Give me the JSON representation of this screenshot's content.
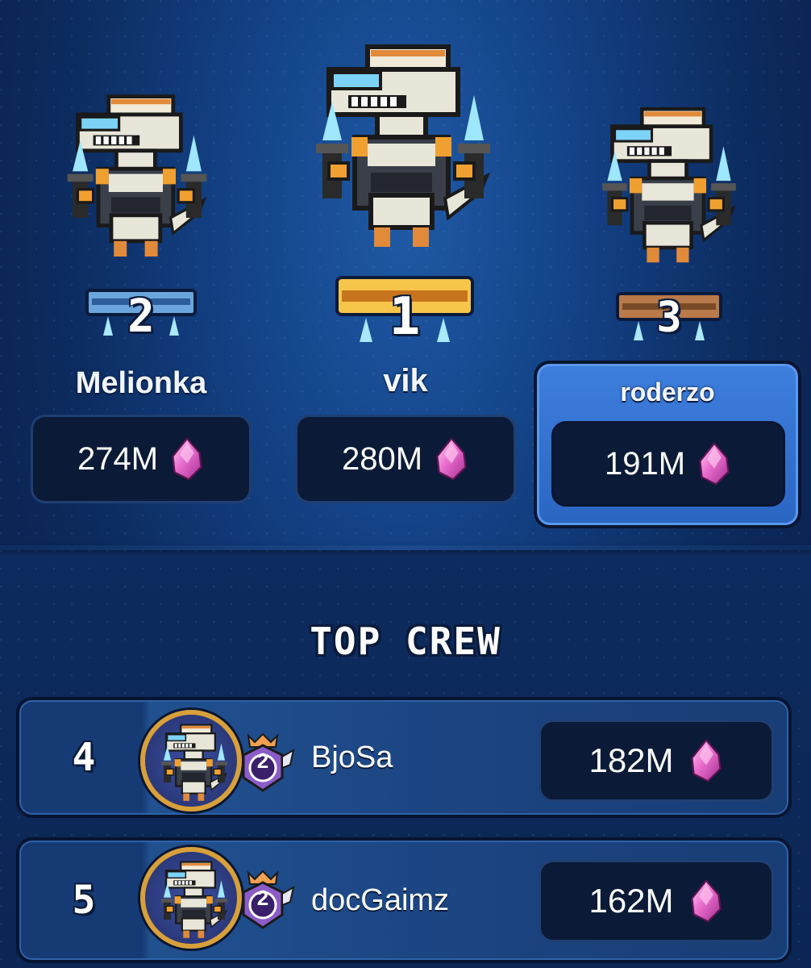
{
  "podium": [
    {
      "rank": "2",
      "name": "Melionka",
      "score": "274M"
    },
    {
      "rank": "1",
      "name": "vik",
      "score": "280M"
    },
    {
      "rank": "3",
      "name": "roderzo",
      "score": "191M"
    }
  ],
  "section": {
    "title": "TOP CREW"
  },
  "list": [
    {
      "rank": "4",
      "name": "BjoSa",
      "badge": "2",
      "score": "182M"
    },
    {
      "rank": "5",
      "name": "docGaimz",
      "badge": "2",
      "score": "162M"
    }
  ],
  "icons": {
    "currency": "pink-gem-icon",
    "avatar": "dino-robot-avatar"
  },
  "colors": {
    "accent": "#3e7fdd",
    "gem": "#e56fc8",
    "gold": "#d8a03a"
  }
}
